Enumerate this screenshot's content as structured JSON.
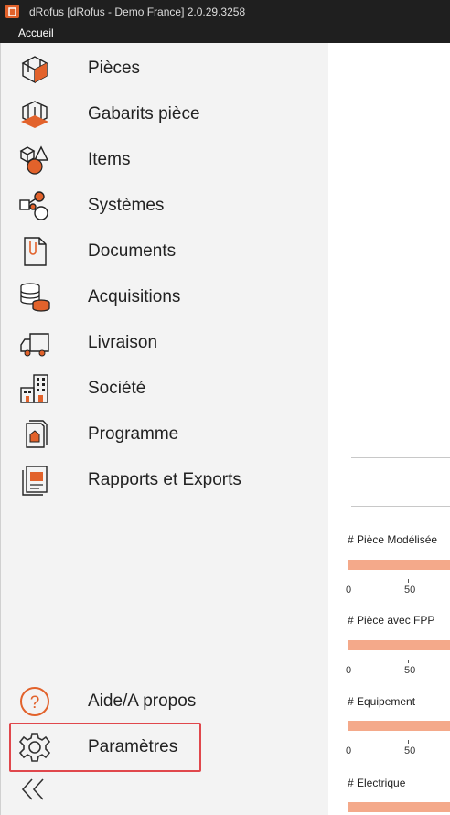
{
  "window": {
    "title": "dRofus [dRofus - Demo France] 2.0.29.3258",
    "menu": [
      "Accueil"
    ]
  },
  "sidebar": {
    "items": [
      {
        "label": "Pièces",
        "icon": "rooms-icon"
      },
      {
        "label": "Gabarits pièce",
        "icon": "room-templates-icon"
      },
      {
        "label": "Items",
        "icon": "items-icon"
      },
      {
        "label": "Systèmes",
        "icon": "systems-icon"
      },
      {
        "label": "Documents",
        "icon": "documents-icon"
      },
      {
        "label": "Acquisitions",
        "icon": "acquisitions-icon"
      },
      {
        "label": "Livraison",
        "icon": "delivery-icon"
      },
      {
        "label": "Société",
        "icon": "company-icon"
      },
      {
        "label": "Programme",
        "icon": "program-icon"
      },
      {
        "label": "Rapports et Exports",
        "icon": "reports-icon"
      }
    ],
    "bottom": [
      {
        "label": "Aide/A propos",
        "icon": "help-icon"
      },
      {
        "label": "Paramètres",
        "icon": "settings-icon"
      }
    ],
    "collapse_icon": "double-chevron-left-icon"
  },
  "dashboard": {
    "stats": [
      {
        "label": "# Pièce Modélisée",
        "ticks": [
          "0",
          "50"
        ]
      },
      {
        "label": "# Pièce avec FPP",
        "ticks": [
          "0",
          "50"
        ]
      },
      {
        "label": "# Equipement",
        "ticks": [
          "0",
          "50"
        ]
      },
      {
        "label": "# Electrique",
        "ticks": []
      }
    ]
  },
  "colors": {
    "accent": "#e2622b",
    "bar": "#f4a98a",
    "highlight": "#e0474c",
    "titlebar": "#1f1f1f",
    "sidebar_bg": "#f3f3f3"
  }
}
